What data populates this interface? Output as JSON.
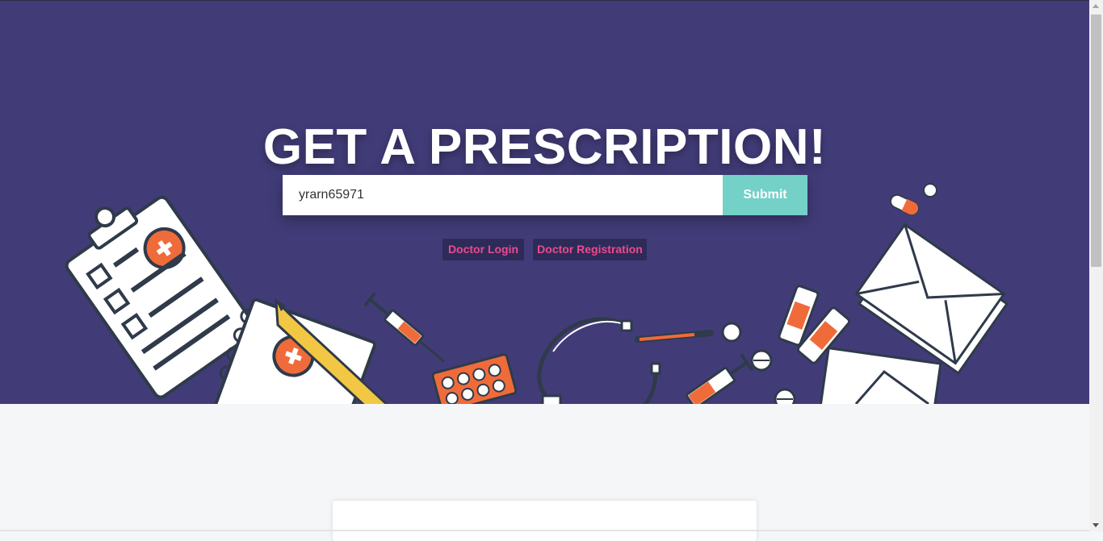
{
  "hero": {
    "title": "GET A PRESCRIPTION!",
    "background_color": "#413c78"
  },
  "search": {
    "value": "yrarn65971",
    "placeholder": "",
    "submit_label": "Submit",
    "submit_color": "#74d1c7"
  },
  "nav": {
    "doctor_login": "Doctor Login",
    "doctor_registration": "Doctor Registration",
    "link_color": "#ec4a8f"
  },
  "illustration": {
    "items": [
      "clipboard-icon",
      "notepad-icon",
      "pencil-icon",
      "syringe-icon",
      "pill-blister-icon",
      "stethoscope-icon",
      "thermometer-icon",
      "bandage-icon",
      "pill-capsule-icon",
      "envelope-icon"
    ]
  }
}
